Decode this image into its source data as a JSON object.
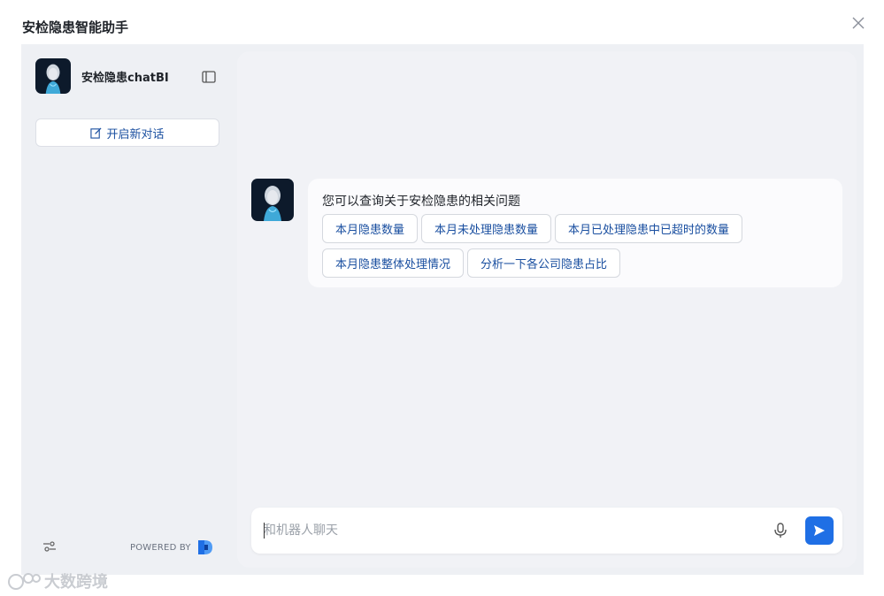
{
  "window": {
    "title": "安检隐患智能助手"
  },
  "sidebar": {
    "bot_name": "安检隐患chatBI",
    "new_chat_label": "开启新对话",
    "powered_by": "POWERED BY"
  },
  "chat": {
    "greeting": "您可以查询关于安检隐患的相关问题",
    "suggestions": [
      "本月隐患数量",
      "本月未处理隐患数量",
      "本月已处理隐患中已超时的数量",
      "本月隐患整体处理情况",
      "分析一下各公司隐患占比"
    ]
  },
  "composer": {
    "placeholder": "和机器人聊天"
  },
  "watermark": "大数跨境",
  "colors": {
    "accent": "#1f6fe5",
    "link": "#1a4fa0",
    "panel": "#eef0f4"
  },
  "icons": [
    "close-icon",
    "sidebar-toggle-icon",
    "edit-icon",
    "settings-icon",
    "brand-logo-icon",
    "microphone-icon",
    "send-icon"
  ]
}
